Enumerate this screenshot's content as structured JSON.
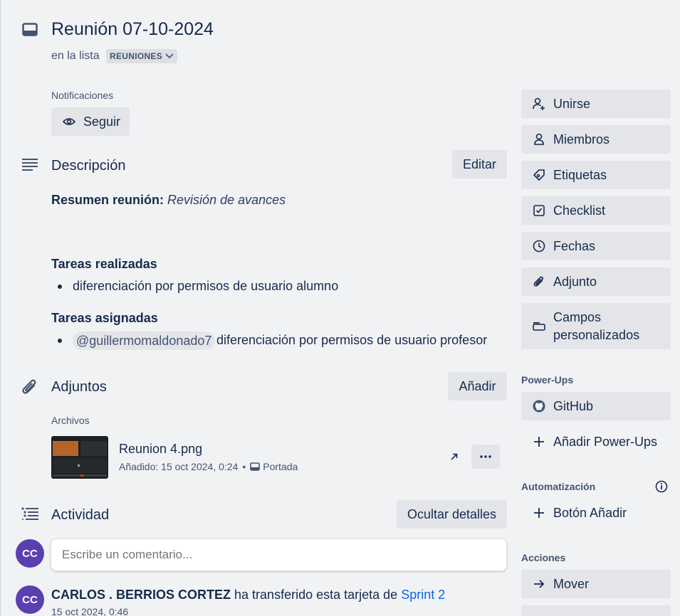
{
  "header": {
    "title": "Reunión 07-10-2024",
    "list_prefix": "en la lista",
    "list_name": "REUNIONES"
  },
  "notifications": {
    "label": "Notificaciones",
    "follow_button": "Seguir"
  },
  "description": {
    "title": "Descripción",
    "edit_button": "Editar",
    "summary_label": "Resumen reunión:",
    "summary_value": "Revisión de avances",
    "done_heading": "Tareas realizadas",
    "done_items": [
      "diferenciación por permisos de usuario alumno"
    ],
    "assigned_heading": "Tareas asignadas",
    "assigned_mention": "@guillermomaldonado7",
    "assigned_text": "diferenciación por permisos de usuario profesor"
  },
  "attachments": {
    "title": "Adjuntos",
    "add_button": "Añadir",
    "files_label": "Archivos",
    "file": {
      "name": "Reunion 4.png",
      "added": "Añadido: 15 oct 2024, 0:24",
      "separator": "•",
      "cover_label": "Portada"
    }
  },
  "activity": {
    "title": "Actividad",
    "hide_button": "Ocultar detalles",
    "comment_placeholder": "Escribe un comentario...",
    "avatar_initials": "CC",
    "entry": {
      "user": "CARLOS . BERRIOS CORTEZ",
      "action": "ha transferido esta tarjeta de",
      "link": "Sprint 2",
      "timestamp": "15 oct 2024, 0:46"
    }
  },
  "sidebar": {
    "add_to_card": [
      {
        "label": "Unirse",
        "icon": "person-add-icon"
      },
      {
        "label": "Miembros",
        "icon": "person-icon"
      },
      {
        "label": "Etiquetas",
        "icon": "tag-icon"
      },
      {
        "label": "Checklist",
        "icon": "checkbox-icon"
      },
      {
        "label": "Fechas",
        "icon": "clock-icon"
      },
      {
        "label": "Adjunto",
        "icon": "paperclip-icon"
      },
      {
        "label": "Campos personalizados",
        "icon": "custom-fields-icon"
      }
    ],
    "powerups_heading": "Power-Ups",
    "github_label": "GitHub",
    "add_powerups_label": "Añadir Power-Ups",
    "automation_heading": "Automatización",
    "add_button_label": "Botón Añadir",
    "actions_heading": "Acciones",
    "move_label": "Mover"
  },
  "colors": {
    "background": "#f1f2f4",
    "button": "#e3e5e9",
    "text": "#172b4d",
    "subtle_text": "#44546f",
    "link": "#0c66e4",
    "avatar": "#5b3fb0"
  }
}
